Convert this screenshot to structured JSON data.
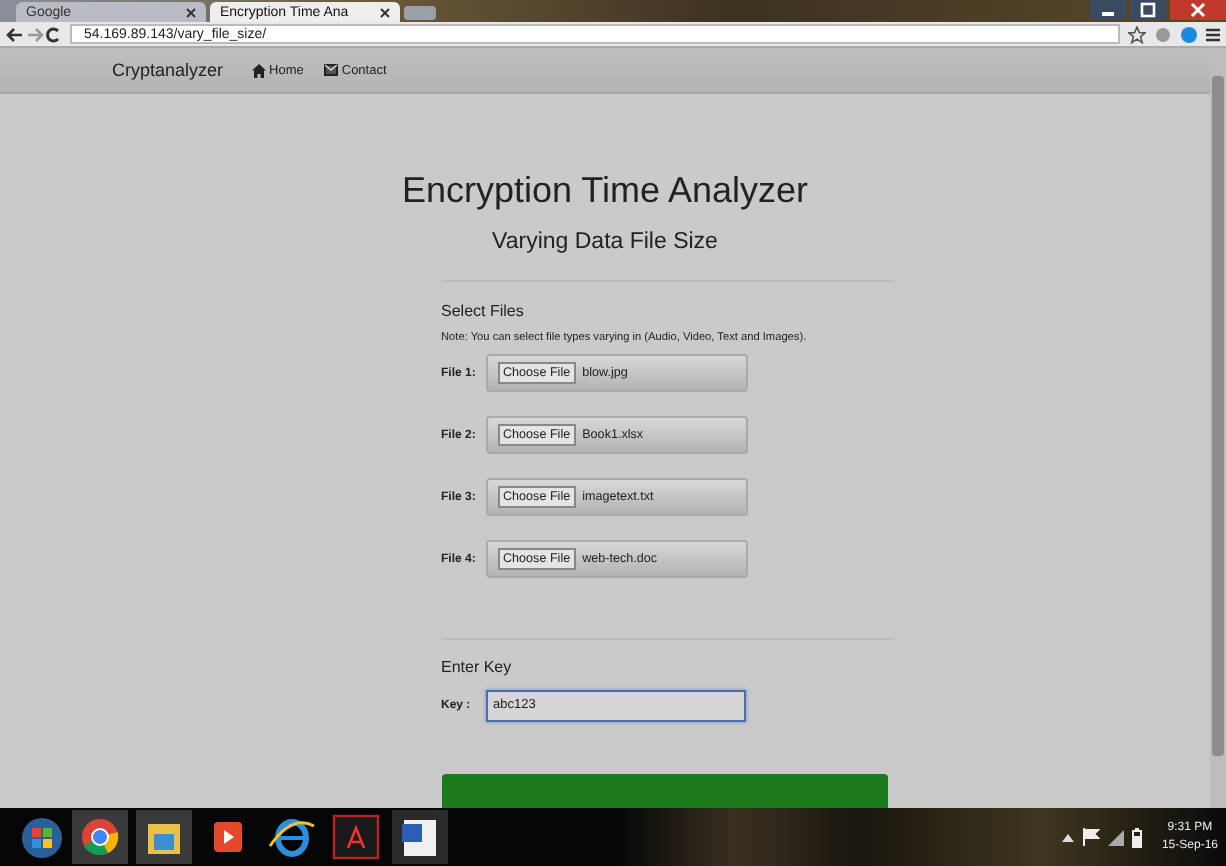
{
  "browser": {
    "tabs": [
      {
        "label": "Google",
        "selected": false
      },
      {
        "label": "Encryption Time Ana",
        "selected": true
      }
    ],
    "address": "54.169.89.143/vary_file_size/"
  },
  "navbar": {
    "brand": "Cryptanalyzer",
    "links": [
      {
        "label": "Home",
        "kind": "home"
      },
      {
        "label": "Contact",
        "kind": "mail"
      }
    ]
  },
  "heading": "Encryption Time Analyzer",
  "subheading": "Varying Data File Size",
  "files": {
    "title": "Select Files",
    "note": "Note: You can select file types varying in (Audio, Video, Text and Images).",
    "items": [
      {
        "label": "File 1:",
        "button": "Choose File",
        "filename": "blow.jpg"
      },
      {
        "label": "File 2:",
        "button": "Choose File",
        "filename": "Book1.xlsx"
      },
      {
        "label": "File 3:",
        "button": "Choose File",
        "filename": "imagetext.txt"
      },
      {
        "label": "File 4:",
        "button": "Choose File",
        "filename": "web-tech.doc"
      }
    ]
  },
  "key": {
    "title": "Enter Key",
    "label": "Key :",
    "value": "abc123"
  },
  "taskbar": {
    "time": "9:31 PM",
    "date": "15-Sep-16"
  }
}
